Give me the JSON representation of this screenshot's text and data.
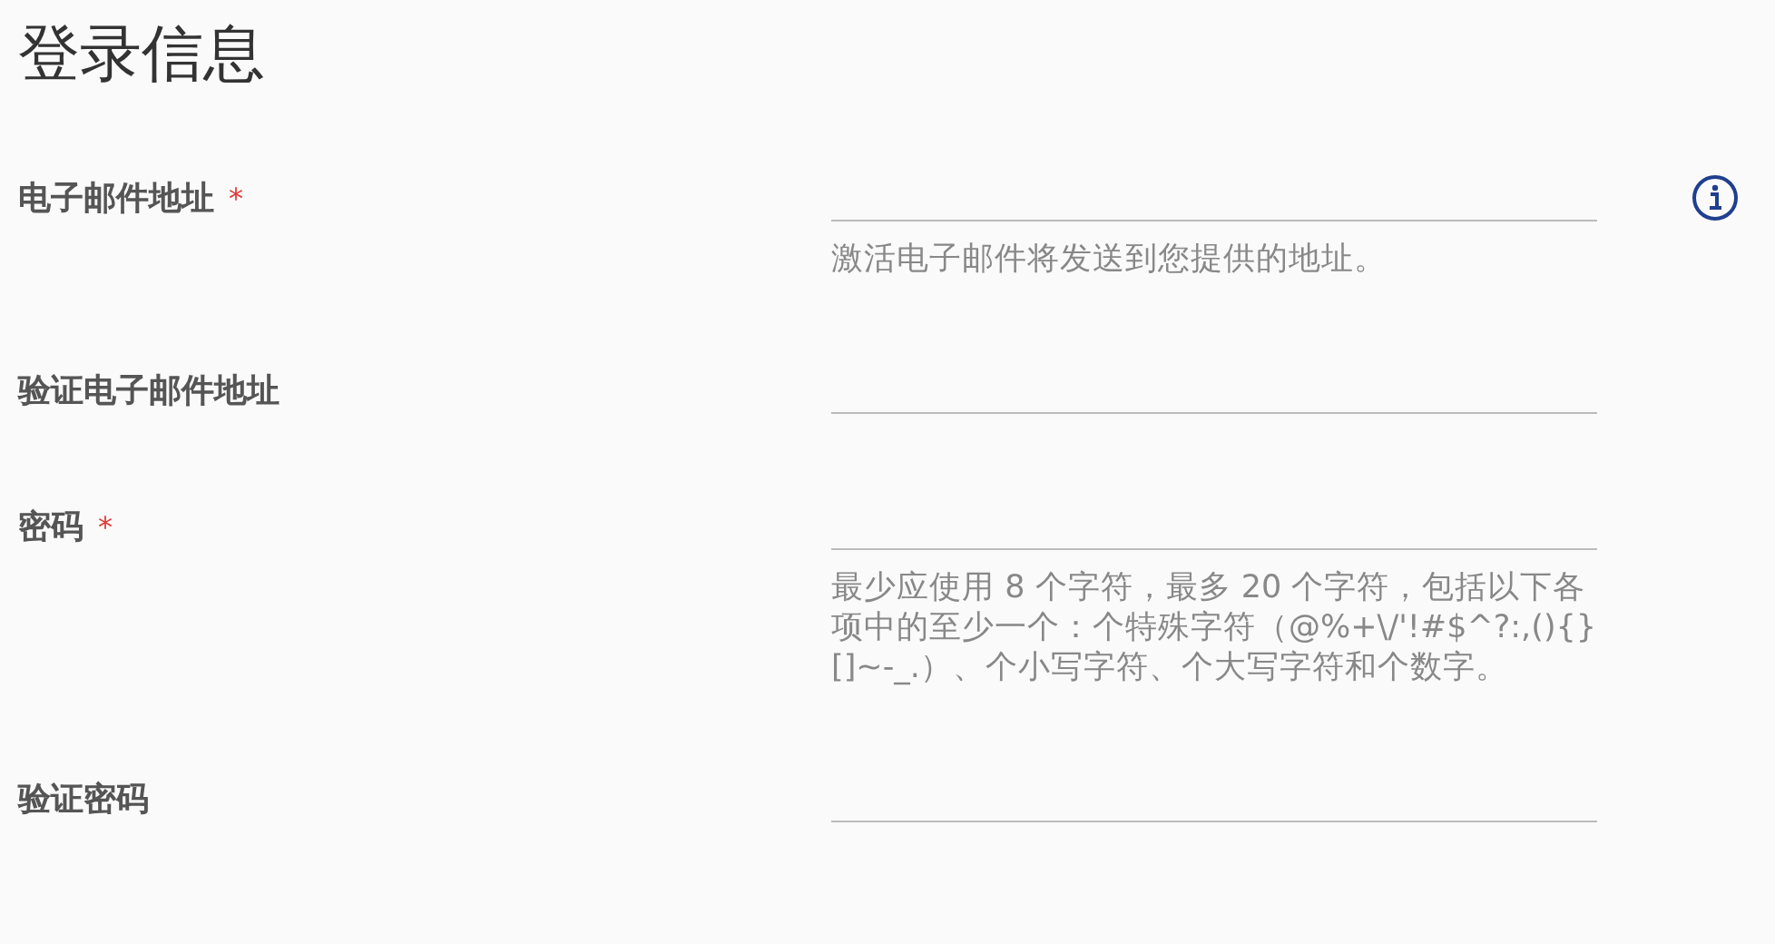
{
  "title": "登录信息",
  "fields": [
    {
      "label": "电子邮件地址",
      "required_mark": "*",
      "info": true,
      "hint": "激活电子邮件将发送到您提供的地址。"
    },
    {
      "label": "验证电子邮件地址",
      "info": false
    },
    {
      "label": "密码",
      "required_mark": "*",
      "info": false,
      "hint": "最少应使用 8 个字符，最多 20 个字符，包括以下各项中的至少一个：个特殊字符（@%+\\/'!#$^?:,(){}[]~-_.）、个小写字符、个大写字符和个数字。"
    },
    {
      "label": "验证密码",
      "info": false
    }
  ]
}
